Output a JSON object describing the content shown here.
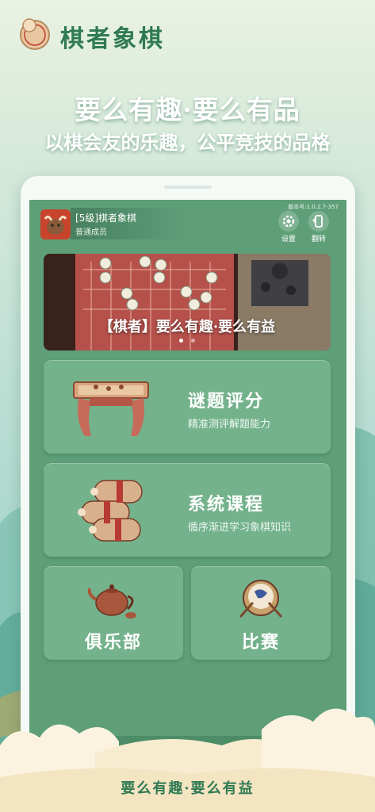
{
  "header": {
    "app_title": "棋者象棋",
    "logo_char": "象"
  },
  "slogans": {
    "line1": "要么有趣·要么有品",
    "line2": "以棋会友的乐趣，公平竞技的品格"
  },
  "app_screen": {
    "version": "版本号:1.0.2.7-357",
    "user": {
      "name": "[5级]棋者象棋",
      "role": "普通成员"
    },
    "buttons": {
      "settings": "设置",
      "flip": "翻转"
    },
    "banner": {
      "text": "【棋者】要么有趣·要么有益",
      "page_count": 2,
      "active_page": 1
    },
    "cards": {
      "puzzle": {
        "title": "谜题评分",
        "subtitle": "精准测评解题能力"
      },
      "course": {
        "title": "系统课程",
        "subtitle": "循序渐进学习象棋知识"
      },
      "club": {
        "title": "俱乐部"
      },
      "match": {
        "title": "比赛"
      }
    }
  },
  "footer": {
    "slogan": "要么有趣·要么有益"
  },
  "colors": {
    "brand_green": "#2f7a52",
    "screen_green": "#5e9f78",
    "card_green": "#74b28c"
  }
}
